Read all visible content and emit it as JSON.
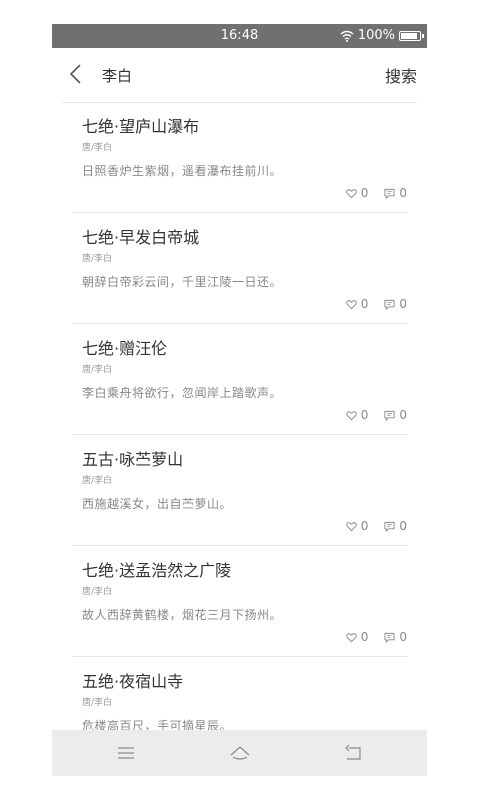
{
  "status": {
    "time": "16:48",
    "battery": "100%"
  },
  "nav": {
    "title": "李白",
    "search_label": "搜索"
  },
  "poems": [
    {
      "title": "七绝·望庐山瀑布",
      "author": "唐/李白",
      "line": "日照香炉生紫烟，遥看瀑布挂前川。",
      "likes": "0",
      "comments": "0"
    },
    {
      "title": "七绝·早发白帝城",
      "author": "唐/李白",
      "line": "朝辞白帝彩云间，千里江陵一日还。",
      "likes": "0",
      "comments": "0"
    },
    {
      "title": "七绝·赠汪伦",
      "author": "唐/李白",
      "line": "李白乘舟将欲行，忽闻岸上踏歌声。",
      "likes": "0",
      "comments": "0"
    },
    {
      "title": "五古·咏苎萝山",
      "author": "唐/李白",
      "line": "西施越溪女，出自苎萝山。",
      "likes": "0",
      "comments": "0"
    },
    {
      "title": "七绝·送孟浩然之广陵",
      "author": "唐/李白",
      "line": "故人西辞黄鹤楼，烟花三月下扬州。",
      "likes": "0",
      "comments": "0"
    },
    {
      "title": "五绝·夜宿山寺",
      "author": "唐/李白",
      "line": "危楼高百尺，手可摘星辰。",
      "likes": "",
      "comments": ""
    }
  ]
}
